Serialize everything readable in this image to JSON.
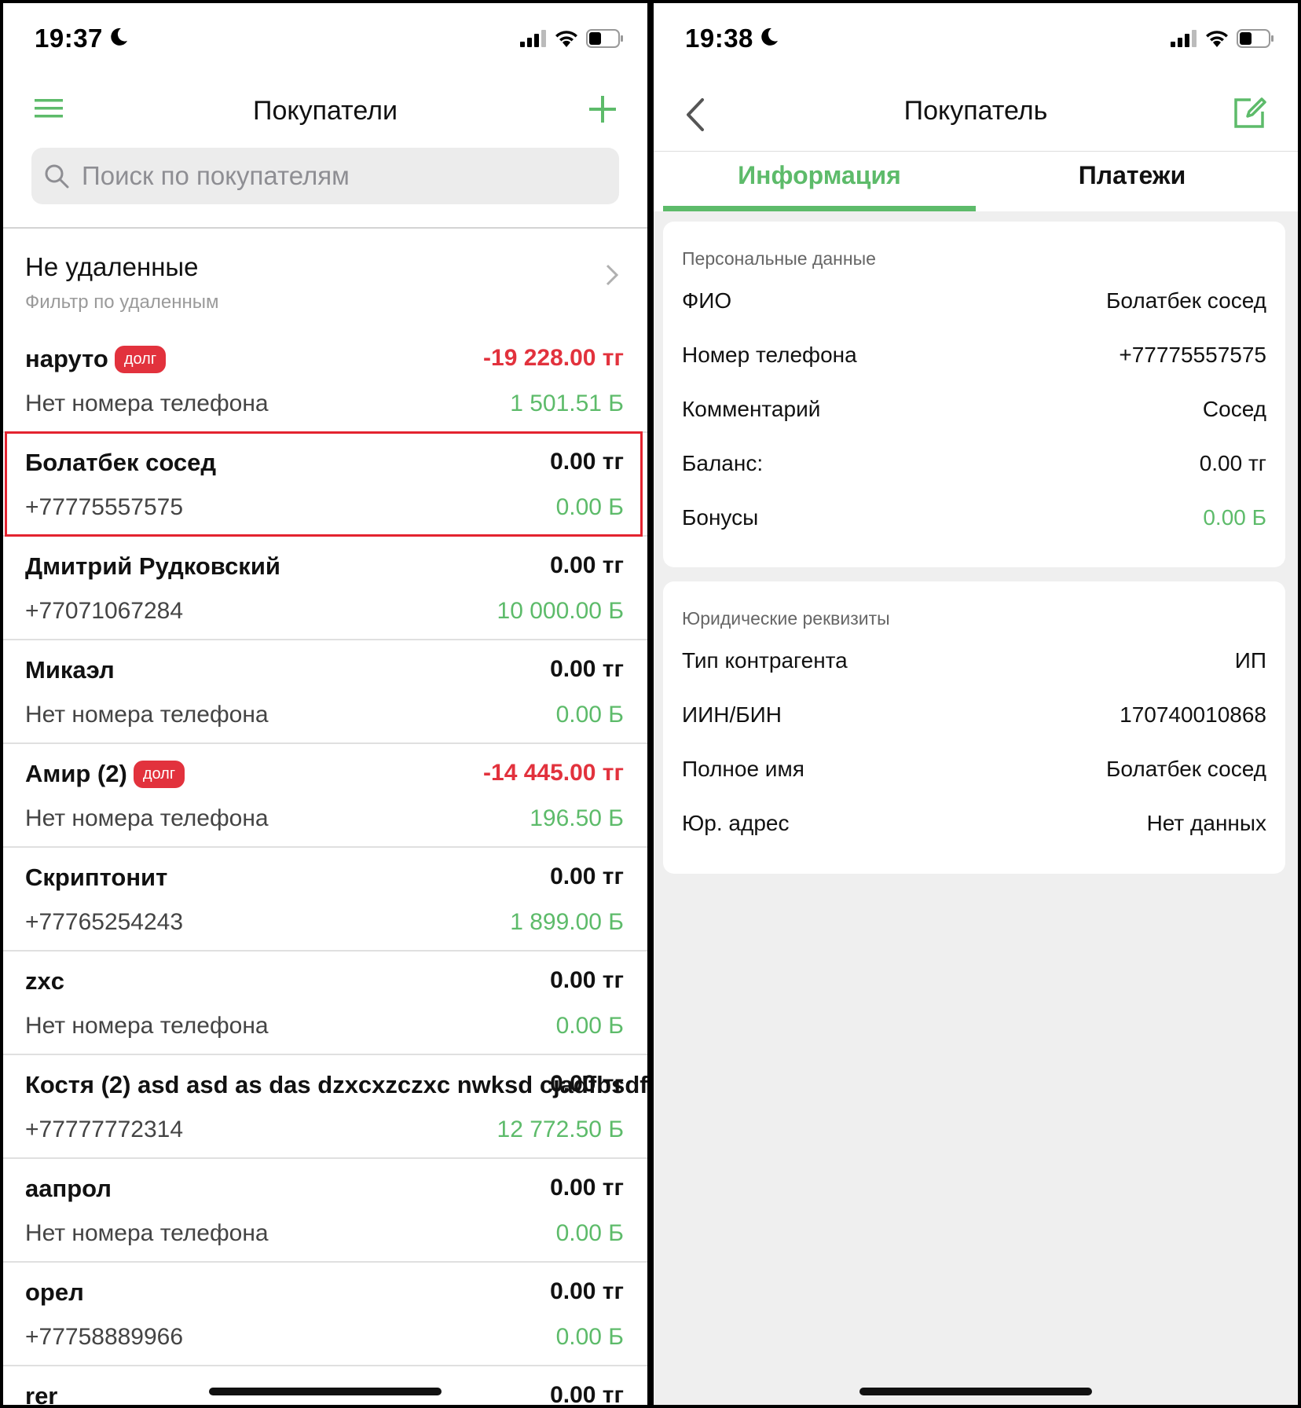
{
  "left": {
    "status_time": "19:37",
    "nav_title": "Покупатели",
    "search_placeholder": "Поиск по покупателям",
    "filter": {
      "title": "Не удаленные",
      "subtitle": "Фильтр по удаленным"
    },
    "debt_badge": "долг",
    "customers": [
      {
        "name": "наруто",
        "debt": true,
        "balance": "-19 228.00 тг",
        "negative": true,
        "phone": "Нет номера телефона",
        "bonus": "1 501.51 Б"
      },
      {
        "name": "Болатбек сосед",
        "debt": false,
        "balance": "0.00 тг",
        "negative": false,
        "phone": "+77775557575",
        "bonus": "0.00 Б"
      },
      {
        "name": "Дмитрий Рудковский",
        "debt": false,
        "balance": "0.00 тг",
        "negative": false,
        "phone": "+77071067284",
        "bonus": "10 000.00 Б"
      },
      {
        "name": "Микаэл",
        "debt": false,
        "balance": "0.00 тг",
        "negative": false,
        "phone": "Нет номера телефона",
        "bonus": "0.00 Б"
      },
      {
        "name": "Амир (2)",
        "debt": true,
        "balance": "-14 445.00 тг",
        "negative": true,
        "phone": "Нет номера телефона",
        "bonus": "196.50 Б"
      },
      {
        "name": "Скриптонит",
        "debt": false,
        "balance": "0.00 тг",
        "negative": false,
        "phone": "+77765254243",
        "bonus": "1 899.00 Б"
      },
      {
        "name": "zxc",
        "debt": false,
        "balance": "0.00 тг",
        "negative": false,
        "phone": "Нет номера телефона",
        "bonus": "0.00 Б"
      },
      {
        "name": "Костя (2) asd asd as das dzxcxzczxc nwksd cjadfbsdf",
        "debt": false,
        "balance": "0.00 тг",
        "negative": false,
        "phone": "+77777772314",
        "bonus": "12 772.50 Б"
      },
      {
        "name": "аапрол",
        "debt": false,
        "balance": "0.00 тг",
        "negative": false,
        "phone": "Нет номера телефона",
        "bonus": "0.00 Б"
      },
      {
        "name": "орел",
        "debt": false,
        "balance": "0.00 тг",
        "negative": false,
        "phone": "+77758889966",
        "bonus": "0.00 Б"
      },
      {
        "name": "rer",
        "debt": false,
        "balance": "0.00 тг",
        "negative": false,
        "phone": "",
        "bonus": ""
      }
    ]
  },
  "right": {
    "status_time": "19:38",
    "nav_title": "Покупатель",
    "tabs": [
      "Информация",
      "Платежи"
    ],
    "personal": {
      "section_title": "Персональные данные",
      "fields": [
        {
          "label": "ФИО",
          "value": "Болатбек сосед"
        },
        {
          "label": "Номер телефона",
          "value": "+77775557575"
        },
        {
          "label": "Комментарий",
          "value": "Сосед"
        },
        {
          "label": "Баланс:",
          "value": "0.00 тг"
        },
        {
          "label": "Бонусы",
          "value": "0.00 Б"
        }
      ]
    },
    "legal": {
      "section_title": "Юридические реквизиты",
      "fields": [
        {
          "label": "Тип контрагента",
          "value": "ИП"
        },
        {
          "label": "ИИН/БИН",
          "value": "170740010868"
        },
        {
          "label": "Полное имя",
          "value": "Болатбек сосед"
        },
        {
          "label": "Юр. адрес",
          "value": "Нет данных"
        }
      ]
    }
  },
  "colors": {
    "accent_green": "#5dbb6a",
    "debt_red": "#e2323d",
    "highlight_red": "#e3232f"
  },
  "icons": [
    "menu-icon",
    "plus-icon",
    "search-icon",
    "chevron-right-icon",
    "back-icon",
    "edit-icon",
    "moon-icon",
    "signal-icon",
    "wifi-icon",
    "battery-icon"
  ]
}
